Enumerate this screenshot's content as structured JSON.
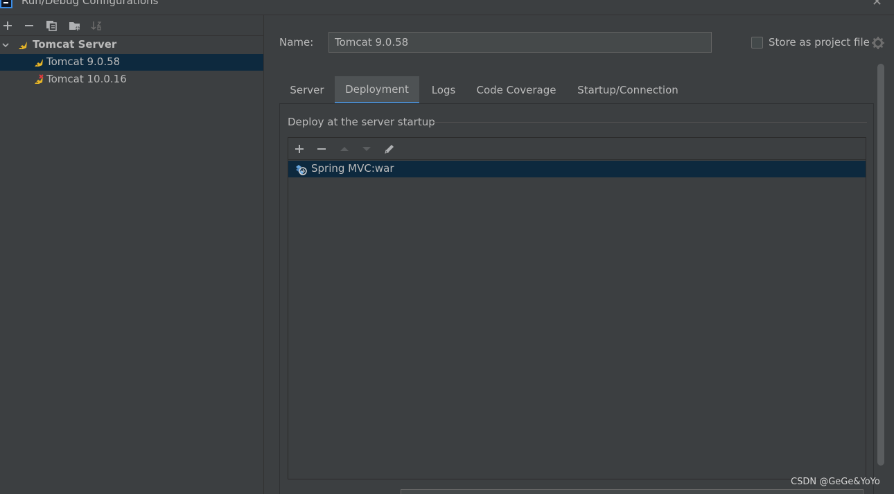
{
  "window": {
    "title": "Run/Debug Configurations",
    "close_glyph": "✕"
  },
  "toolbar": {
    "items": [
      "add-icon",
      "remove-icon",
      "copy-icon",
      "folder-add-icon",
      "sort-icon"
    ]
  },
  "tree": {
    "group_label": "Tomcat Server",
    "items": [
      {
        "label": "Tomcat 9.0.58",
        "selected": true
      },
      {
        "label": "Tomcat 10.0.16",
        "selected": false
      }
    ]
  },
  "config": {
    "name_label": "Name:",
    "name_value": "Tomcat 9.0.58",
    "store_label": "Store as project file",
    "store_checked": false
  },
  "tabs": [
    {
      "label": "Server",
      "active": false
    },
    {
      "label": "Deployment",
      "active": true
    },
    {
      "label": "Logs",
      "active": false
    },
    {
      "label": "Code Coverage",
      "active": false
    },
    {
      "label": "Startup/Connection",
      "active": false
    }
  ],
  "deployment": {
    "section_title": "Deploy at the server startup",
    "artifacts": [
      {
        "label": "Spring MVC:war",
        "selected": true
      }
    ]
  },
  "watermark": "CSDN @GeGe&YoYo",
  "colors": {
    "background": "#3c3f41",
    "selection": "#0d293e",
    "tab_active_underline": "#4a88c7",
    "tomcat_icon": "#e4b429"
  }
}
